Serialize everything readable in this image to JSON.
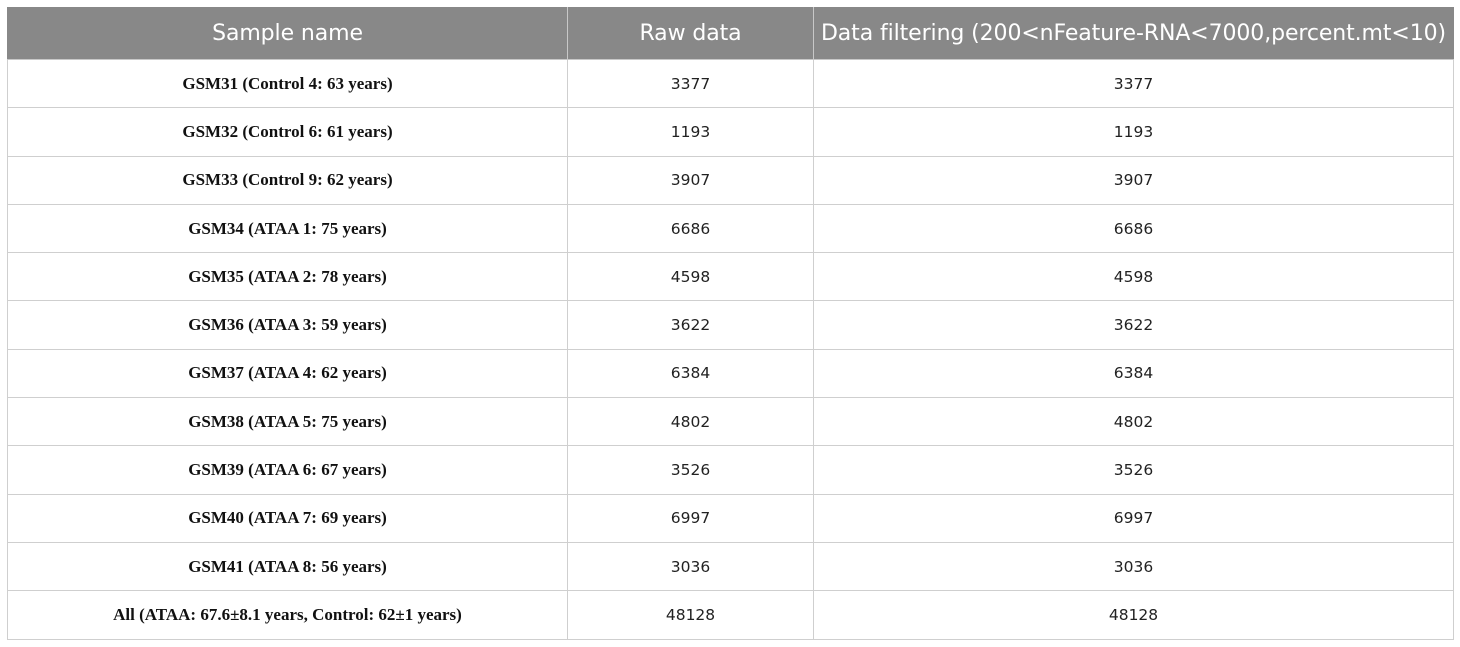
{
  "table": {
    "headers": [
      "Sample name",
      "Raw data",
      "Data filtering (200<nFeature-RNA<7000,percent.mt<10)"
    ],
    "rows": [
      {
        "name": "GSM31 (Control 4: 63 years)",
        "raw": "3377",
        "filtered": "3377"
      },
      {
        "name": "GSM32 (Control 6: 61 years)",
        "raw": "1193",
        "filtered": "1193"
      },
      {
        "name": "GSM33 (Control 9: 62 years)",
        "raw": "3907",
        "filtered": "3907"
      },
      {
        "name": "GSM34 (ATAA 1: 75 years)",
        "raw": "6686",
        "filtered": "6686"
      },
      {
        "name": "GSM35 (ATAA 2: 78 years)",
        "raw": "4598",
        "filtered": "4598"
      },
      {
        "name": "GSM36 (ATAA 3: 59 years)",
        "raw": "3622",
        "filtered": "3622"
      },
      {
        "name": "GSM37 (ATAA 4: 62 years)",
        "raw": "6384",
        "filtered": "6384"
      },
      {
        "name": "GSM38 (ATAA 5: 75 years)",
        "raw": "4802",
        "filtered": "4802"
      },
      {
        "name": "GSM39 (ATAA 6: 67 years)",
        "raw": "3526",
        "filtered": "3526"
      },
      {
        "name": "GSM40 (ATAA 7: 69 years)",
        "raw": "6997",
        "filtered": "6997"
      },
      {
        "name": "GSM41 (ATAA 8: 56 years)",
        "raw": "3036",
        "filtered": "3036"
      },
      {
        "name": "All (ATAA: 67.6±8.1 years, Control: 62±1 years)",
        "raw": "48128",
        "filtered": "48128"
      }
    ]
  },
  "colors": {
    "header_bg": "#888888",
    "header_text": "#ffffff",
    "border": "#cfcfcf"
  }
}
